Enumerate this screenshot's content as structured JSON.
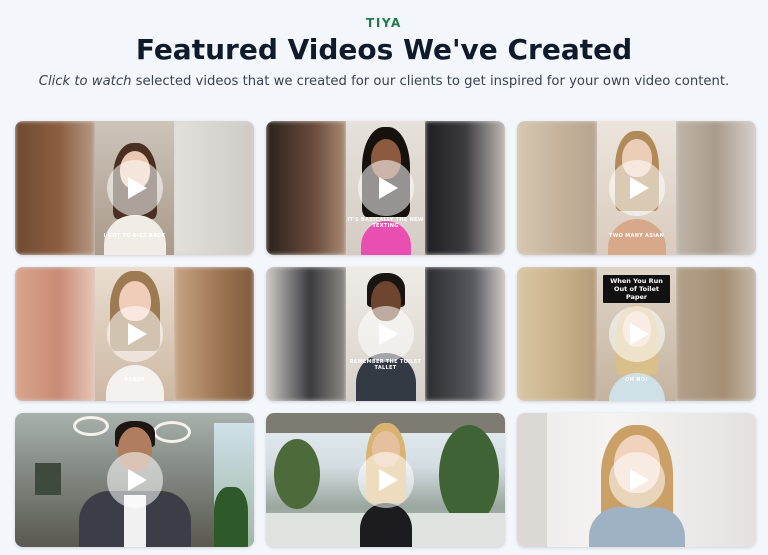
{
  "header": {
    "eyebrow": "TIYA",
    "title": "Featured Videos We've Created",
    "subtitle_italic": "Click to watch",
    "subtitle_rest": " selected videos that we created for our clients to get inspired for your own video content."
  },
  "videos": [
    {
      "caption": "I GOT TO BIZZ BACK",
      "top_caption": "",
      "icon": "play-icon"
    },
    {
      "caption": "IT'S BASICALLY THE NEW TEXTING",
      "top_caption": "",
      "icon": "play-icon"
    },
    {
      "caption": "TWO MANY ASIAN",
      "top_caption": "",
      "icon": "play-icon"
    },
    {
      "caption": "RANDY",
      "top_caption": "",
      "icon": "play-icon"
    },
    {
      "caption": "REMEMBER THE TOILET TALLET",
      "top_caption": "",
      "icon": "play-icon"
    },
    {
      "caption": "OH NO!",
      "top_caption": "When You Run Out of Toilet Paper",
      "icon": "play-icon"
    },
    {
      "caption": "",
      "top_caption": "",
      "icon": "play-icon"
    },
    {
      "caption": "",
      "top_caption": "",
      "icon": "play-icon"
    },
    {
      "caption": "",
      "top_caption": "",
      "icon": "play-icon"
    }
  ],
  "colors": {
    "background": "#f3f6fa",
    "eyebrow": "#1f7a4a",
    "title": "#0f1a2a",
    "play_overlay": "rgba(255,255,255,0.55)"
  }
}
